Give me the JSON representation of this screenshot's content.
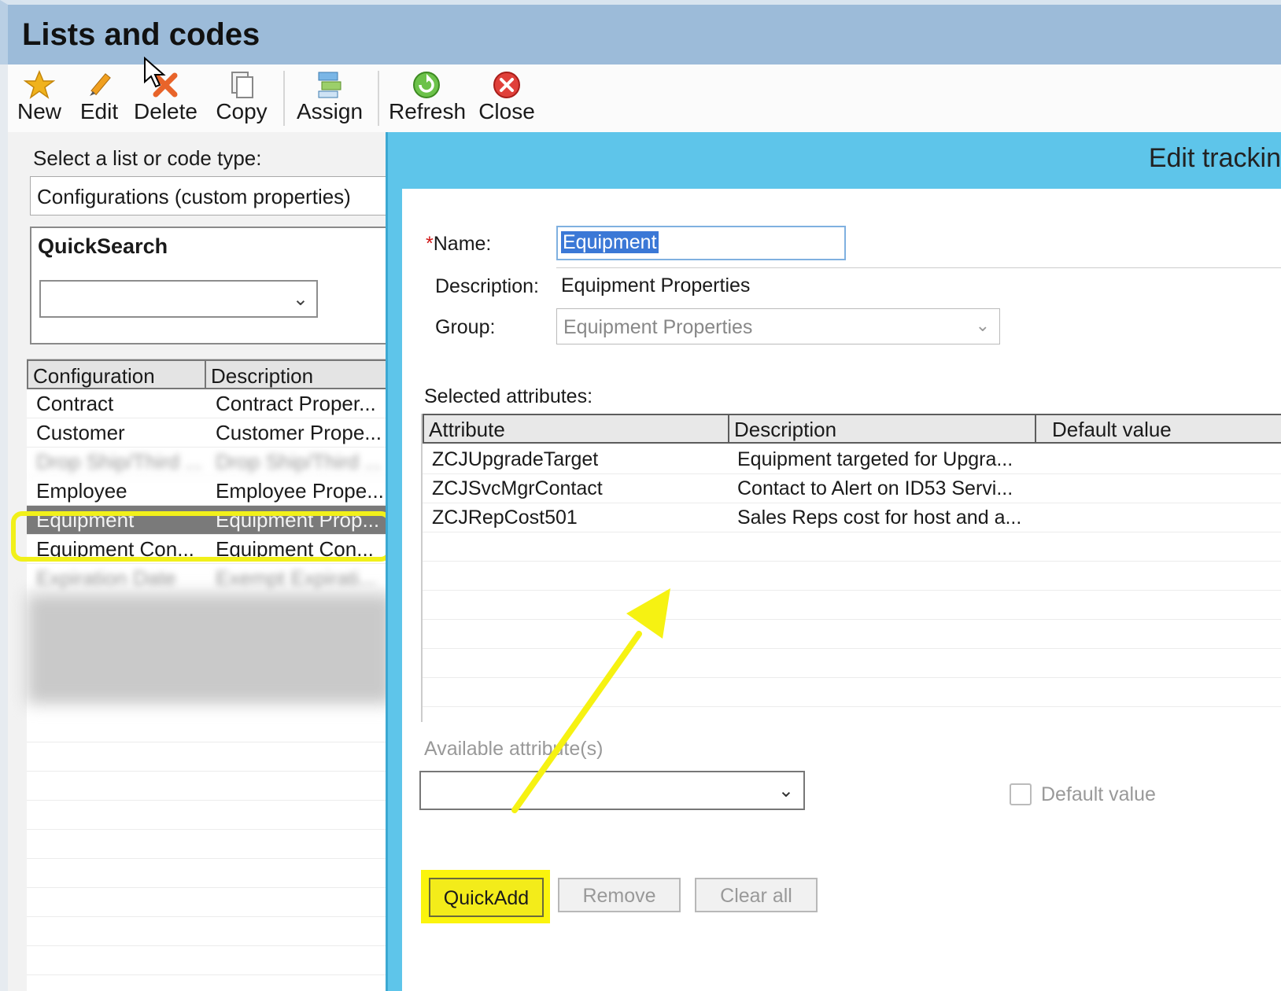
{
  "window": {
    "title": "Lists and codes"
  },
  "toolbar": {
    "items": [
      {
        "label": "New",
        "icon": "star-icon"
      },
      {
        "label": "Edit",
        "icon": "pencil-icon"
      },
      {
        "label": "Delete",
        "icon": "delete-x-icon"
      },
      {
        "label": "Copy",
        "icon": "copy-icon"
      },
      {
        "label": "Assign",
        "icon": "assign-icon"
      },
      {
        "label": "Refresh",
        "icon": "refresh-icon"
      },
      {
        "label": "Close",
        "icon": "close-circle-icon"
      }
    ]
  },
  "left": {
    "select_label": "Select a list or code type:",
    "select_value": "Configurations (custom properties)",
    "quicksearch": {
      "title": "QuickSearch",
      "value": ""
    },
    "grid": {
      "columns": [
        "Configuration",
        "Description"
      ],
      "rows": [
        [
          "Contract",
          "Contract Proper..."
        ],
        [
          "Customer",
          "Customer Prope..."
        ],
        [
          "Drop Ship/Third ...",
          "Drop Ship/Third ..."
        ],
        [
          "Employee",
          "Employee Prope..."
        ],
        [
          "Equipment",
          "Equipment Prop..."
        ],
        [
          "Equipment Con...",
          "Equipment Con..."
        ],
        [
          "Expiration Date",
          "Exempt Expirati..."
        ]
      ],
      "selected_index": 4
    }
  },
  "dialog": {
    "title": "Edit trackin",
    "name_label": "Name:",
    "name_required_mark": "*",
    "name_value": "Equipment",
    "description_label": "Description:",
    "description_value": "Equipment Properties",
    "group_label": "Group:",
    "group_value": "Equipment Properties",
    "selected_attributes_label": "Selected attributes:",
    "attr_columns": [
      "Attribute",
      "Description",
      "Default value"
    ],
    "attr_rows": [
      [
        "ZCJUpgradeTarget",
        "Equipment targeted for Upgra..."
      ],
      [
        "ZCJSvcMgrContact",
        "Contact to Alert on ID53 Servi..."
      ],
      [
        "ZCJRepCost501",
        "Sales Reps cost for host and a..."
      ]
    ],
    "highlighted_row": 2,
    "available_label": "Available attribute(s)",
    "available_value": "",
    "default_value_label": "Default value",
    "buttons": {
      "quickadd": "QuickAdd",
      "remove": "Remove",
      "clear_all": "Clear all"
    }
  },
  "colors": {
    "highlight": "#fbf40d",
    "dialog_border": "#5ec5ea",
    "titlebar": "#9cbbd9",
    "selection": "#7a7a7a"
  }
}
